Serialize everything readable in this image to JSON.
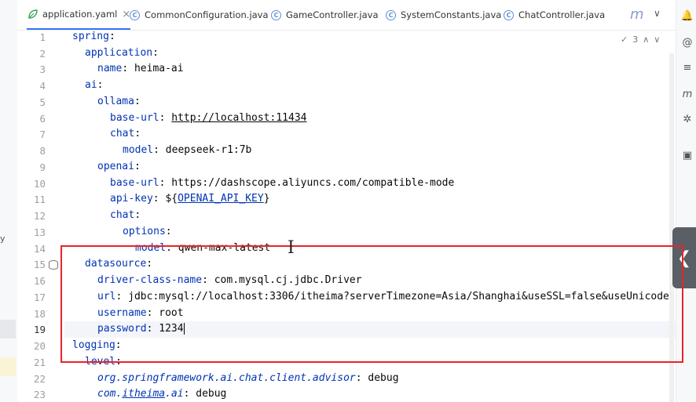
{
  "tabs": [
    {
      "label": "application.yaml",
      "icon": "yaml-leaf-icon",
      "active": true,
      "close": "×"
    },
    {
      "label": "CommonConfiguration.java",
      "icon": "class-icon"
    },
    {
      "label": "GameController.java",
      "icon": "class-icon"
    },
    {
      "label": "SystemConstants.java",
      "icon": "class-icon"
    },
    {
      "label": "ChatController.java",
      "icon": "class-icon"
    }
  ],
  "tab_overflow": {
    "more": "m",
    "chevron": "∨",
    "menu": "⋮"
  },
  "inspection_hint": {
    "count": "3",
    "up": "∧",
    "down": "∨"
  },
  "line_numbers": [
    "1",
    "2",
    "3",
    "4",
    "5",
    "6",
    "7",
    "8",
    "9",
    "10",
    "11",
    "12",
    "13",
    "14",
    "15",
    "16",
    "17",
    "18",
    "19",
    "20",
    "21",
    "22",
    "23"
  ],
  "current_line": "19",
  "code": {
    "l1": {
      "key": "spring",
      "sep": ":"
    },
    "l2": {
      "key": "application",
      "sep": ":"
    },
    "l3": {
      "key": "name",
      "sep": ": ",
      "value": "heima-ai"
    },
    "l4": {
      "key": "ai",
      "sep": ":"
    },
    "l5": {
      "key": "ollama",
      "sep": ":"
    },
    "l6": {
      "key": "base-url",
      "sep": ": ",
      "value": "http://localhost:11434"
    },
    "l7": {
      "key": "chat",
      "sep": ":"
    },
    "l8": {
      "key": "model",
      "sep": ": ",
      "value": "deepseek-r1:7b"
    },
    "l9": {
      "key": "openai",
      "sep": ":"
    },
    "l10": {
      "key": "base-url",
      "sep": ": ",
      "value": "https://dashscope.aliyuncs.com/compatible-mode"
    },
    "l11": {
      "key": "api-key",
      "sep": ": ",
      "value_prefix": "${",
      "value_var": "OPENAI_API_KEY",
      "value_suffix": "}"
    },
    "l12": {
      "key": "chat",
      "sep": ":"
    },
    "l13": {
      "key": "options",
      "sep": ":"
    },
    "l14": {
      "key": "model",
      "sep": ": ",
      "value": "qwen-max-latest"
    },
    "l15": {
      "key": "datasource",
      "sep": ":"
    },
    "l16": {
      "key": "driver-class-name",
      "sep": ": ",
      "value": "com.mysql.cj.jdbc.Driver"
    },
    "l17": {
      "key": "url",
      "sep": ": ",
      "value": "jdbc:mysql://localhost:3306/itheima?serverTimezone=Asia/Shanghai&useSSL=false&useUnicode"
    },
    "l18": {
      "key": "username",
      "sep": ": ",
      "value": "root"
    },
    "l19": {
      "key": "password",
      "sep": ": ",
      "value": "1234"
    },
    "l20": {
      "key": "logging",
      "sep": ":"
    },
    "l21": {
      "key": "level",
      "sep": ":"
    },
    "l22": {
      "key": "org.springframework.ai.chat.client.advisor",
      "sep": ": ",
      "value": "debug"
    },
    "l23": {
      "key_a": "com.",
      "key_b": "itheima",
      "key_c": ".ai",
      "sep": ": ",
      "value": "debug"
    }
  },
  "right_toolbar": [
    "notifications-icon",
    "ai-assistant-icon",
    "database-icon",
    "maven-icon",
    "plugin-icon",
    "structure-icon"
  ],
  "colors": {
    "highlight_box": "#e8242b",
    "key": "#0033b3",
    "active_tab": "#3574f0"
  }
}
